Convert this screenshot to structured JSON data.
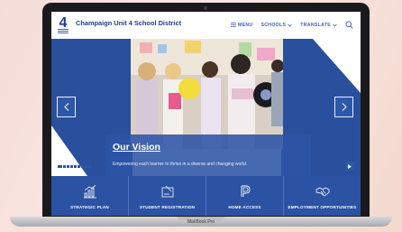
{
  "header": {
    "site_title": "Champaign Unit 4 School District",
    "logo_text": "4",
    "nav": [
      {
        "label": "MENU",
        "icon": "hamburger-icon"
      },
      {
        "label": "SCHOOLS",
        "icon": "chevron-down-icon"
      },
      {
        "label": "TRANSLATE",
        "icon": "chevron-down-icon"
      }
    ],
    "search_icon": "search-icon"
  },
  "hero": {
    "title": "Our Vision",
    "text": "Empowering each learner to thrive in a diverse and changing world.",
    "slide_count": 9,
    "active_slide": 1
  },
  "quick_links": [
    {
      "label": "STRATEGIC PLAN",
      "icon": "bar-chart-icon"
    },
    {
      "label": "STUDENT REGISTRATION",
      "icon": "form-icon"
    },
    {
      "label": "HOME ACCESS",
      "icon": "parent-portal-icon"
    },
    {
      "label": "EMPLOYMENT OPPORTUNITIES",
      "icon": "handshake-icon"
    }
  ],
  "device": {
    "label": "MacBook Pro"
  },
  "colors": {
    "brand_blue": "#2b52a3",
    "title_blue": "#1f3f8f",
    "nav_blue": "#3c63b6"
  }
}
